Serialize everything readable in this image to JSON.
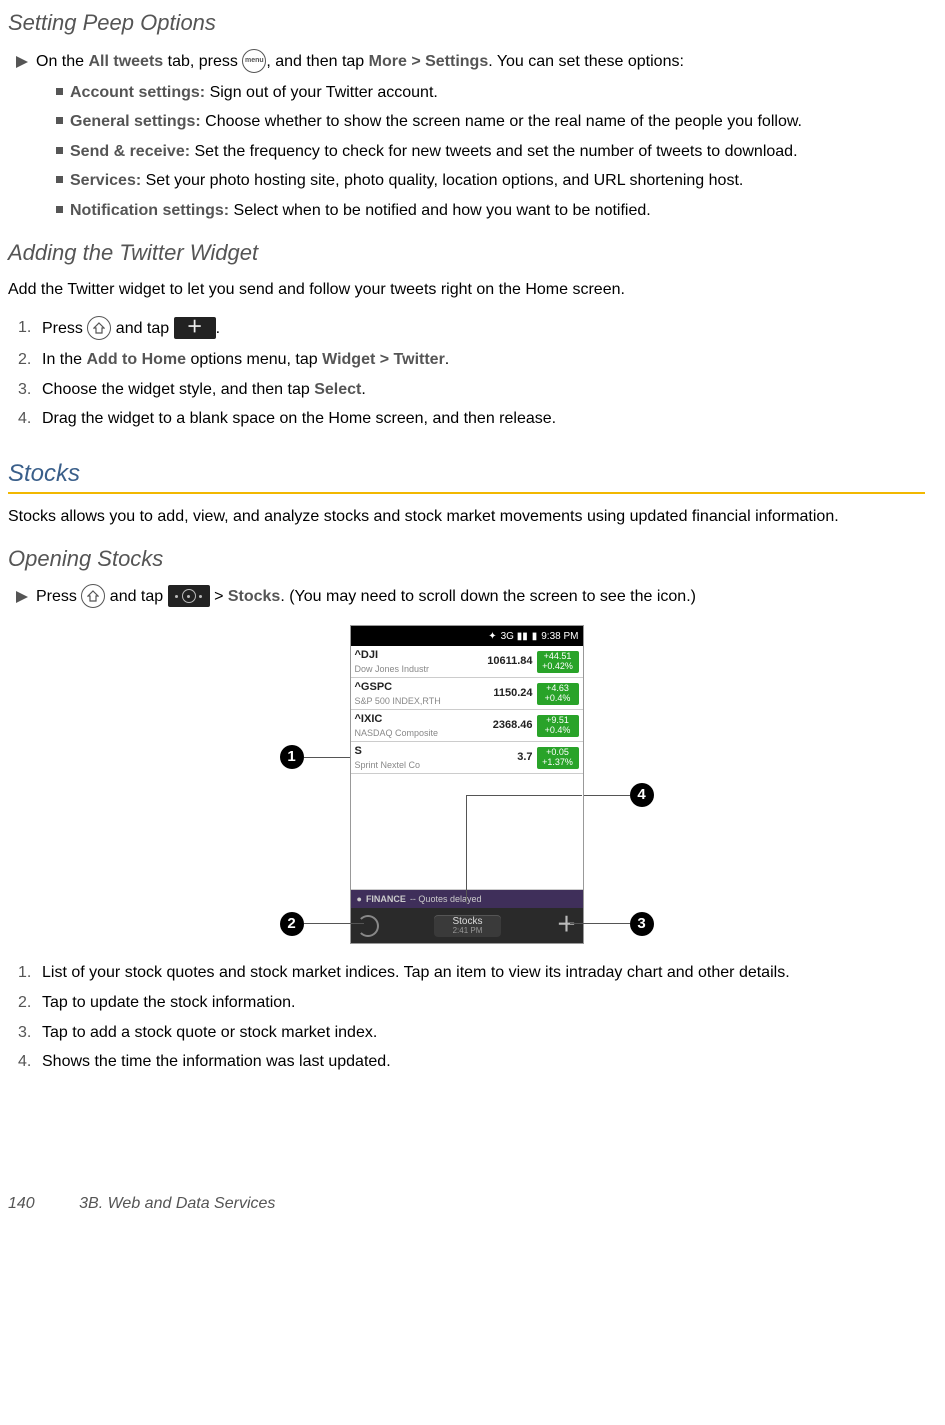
{
  "headings": {
    "peep": "Setting Peep Options",
    "twitter_widget": "Adding the Twitter Widget",
    "stocks": "Stocks",
    "opening_stocks": "Opening Stocks"
  },
  "peep_intro": {
    "pre": "On the ",
    "bold1": "All tweets",
    "mid1": " tab, press ",
    "mid2": ", and then tap ",
    "bold2": "More > Settings",
    "post": ". You can set these options:"
  },
  "peep_items": [
    {
      "label": "Account settings:",
      "text": " Sign out of your Twitter account."
    },
    {
      "label": "General settings:",
      "text": " Choose whether to show the screen name or the real name of the people you follow."
    },
    {
      "label": "Send & receive:",
      "text": " Set the frequency to check for new tweets and set the number of tweets to download."
    },
    {
      "label": "Services:",
      "text": " Set your photo hosting site, photo quality, location options, and URL shortening host."
    },
    {
      "label": "Notification settings:",
      "text": " Select when to be notified and how you want to be notified."
    }
  ],
  "twitter_intro": "Add the Twitter widget to let you send and follow your tweets right on the Home screen.",
  "twitter_steps": {
    "s1a": "Press ",
    "s1b": " and tap ",
    "s1c": ".",
    "s2a": "In the ",
    "s2b": "Add to Home",
    "s2c": " options menu, tap ",
    "s2d": "Widget > Twitter",
    "s2e": ".",
    "s3a": "Choose the widget style, and then tap ",
    "s3b": "Select",
    "s3c": ".",
    "s4": "Drag the widget to a blank space on the Home screen, and then release."
  },
  "numbers": {
    "n1": "1.",
    "n2": "2.",
    "n3": "3.",
    "n4": "4."
  },
  "stocks_intro": "Stocks allows you to add, view, and analyze stocks and stock market movements using updated financial information.",
  "opening_stocks_line": {
    "pre": "Press ",
    "mid1": " and tap ",
    "mid2": " > ",
    "bold": "Stocks",
    "post": ". (You may need to scroll down the screen to see the icon.)"
  },
  "phone": {
    "status_time": "9:38 PM",
    "rows": [
      {
        "sym": "^DJI",
        "desc": "Dow Jones Industr",
        "price": "10611.84",
        "chg1": "+44.51",
        "chg2": "+0.42%"
      },
      {
        "sym": "^GSPC",
        "desc": "S&P 500 INDEX,RTH",
        "price": "1150.24",
        "chg1": "+4.63",
        "chg2": "+0.4%"
      },
      {
        "sym": "^IXIC",
        "desc": "NASDAQ Composite",
        "price": "2368.46",
        "chg1": "+9.51",
        "chg2": "+0.4%"
      },
      {
        "sym": "S",
        "desc": "Sprint Nextel Co",
        "price": "3.7",
        "chg1": "+0.05",
        "chg2": "+1.37%"
      }
    ],
    "finance_label": "FINANCE",
    "finance_note": "-- Quotes delayed",
    "tab_label": "Stocks",
    "tab_time": "2:41 PM"
  },
  "callouts": {
    "c1": "1",
    "c2": "2",
    "c3": "3",
    "c4": "4"
  },
  "stocks_steps": [
    "List of your stock quotes and stock market indices. Tap an item to view its intraday chart and other details.",
    "Tap to update the stock information.",
    "Tap to add a stock quote or stock market index.",
    "Shows the time the information was last updated."
  ],
  "footer": {
    "page": "140",
    "section": "3B. Web and Data Services"
  }
}
